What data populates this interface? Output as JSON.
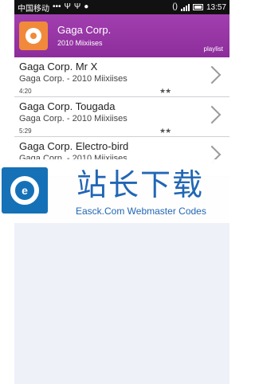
{
  "statusbar": {
    "carrier": "中国移动",
    "dots": "•••",
    "usb_a": "Ψ",
    "usb_b": "Ψ",
    "notif": "●",
    "vibrate": "()",
    "time": "13:57"
  },
  "header": {
    "title": "Gaga Corp.",
    "subtitle": "2010 Miixiises",
    "playlist_label": "playlist"
  },
  "tracks": [
    {
      "title": "Gaga Corp. Mr X",
      "subtitle": "Gaga Corp. - 2010 Miixiises",
      "duration": "4:20",
      "rating": "★★"
    },
    {
      "title": "Gaga Corp. Tougada",
      "subtitle": "Gaga Corp. - 2010 Miixiises",
      "duration": "5:29",
      "rating": "★★"
    },
    {
      "title": "Gaga Corp. Electro-bird",
      "subtitle": "Gaga Corp. - 2010 Miixiises",
      "duration": "",
      "rating": ""
    }
  ],
  "watermark": {
    "logo_glyph": "e",
    "big_text": "站长下载",
    "small_text": "Easck.Com Webmaster Codes"
  },
  "colors": {
    "header": "#9b36a8",
    "album_art": "#f08a3a",
    "watermark_blue": "#1b62b3"
  }
}
